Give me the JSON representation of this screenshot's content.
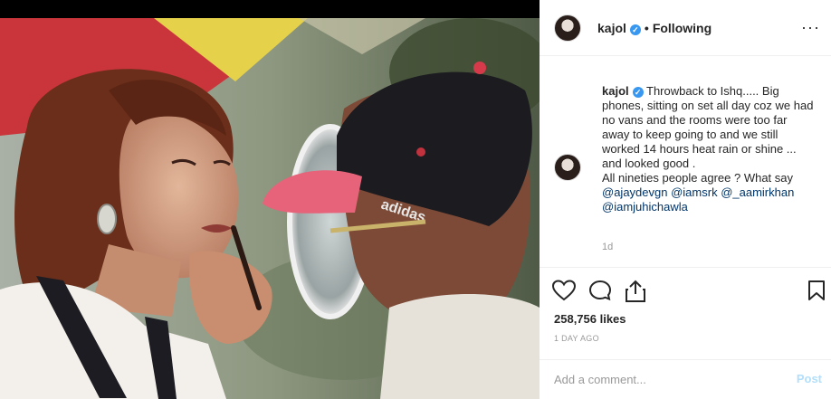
{
  "post": {
    "username": "kajol",
    "verified_mark": "✓",
    "separator": "•",
    "follow_status": "Following",
    "more_label": "···",
    "caption_text": "Throwback to Ishq..... Big phones, sitting on set all day coz we had no vans and the rooms were too far away to keep going to and we still worked 14 hours heat rain or shine ... and looked good .",
    "caption_line2": "All nineties people agree ? What say",
    "mentions": [
      "@ajaydevgn",
      "@iamsrk",
      "@_aamirkhan",
      "@iamjuhichawla"
    ],
    "comment_time": "1d",
    "likes": "258,756 likes",
    "posted_ago": "1 DAY AGO",
    "comment_placeholder": "Add a comment...",
    "post_label": "Post"
  },
  "icons": {
    "like": "heart-icon",
    "comment": "comment-icon",
    "share": "share-icon",
    "save": "bookmark-icon",
    "verified": "verified-badge-icon"
  },
  "colors": {
    "verified": "#3897f0",
    "mention": "#003569",
    "post_disabled": "#b2dffc",
    "muted": "#999999"
  }
}
